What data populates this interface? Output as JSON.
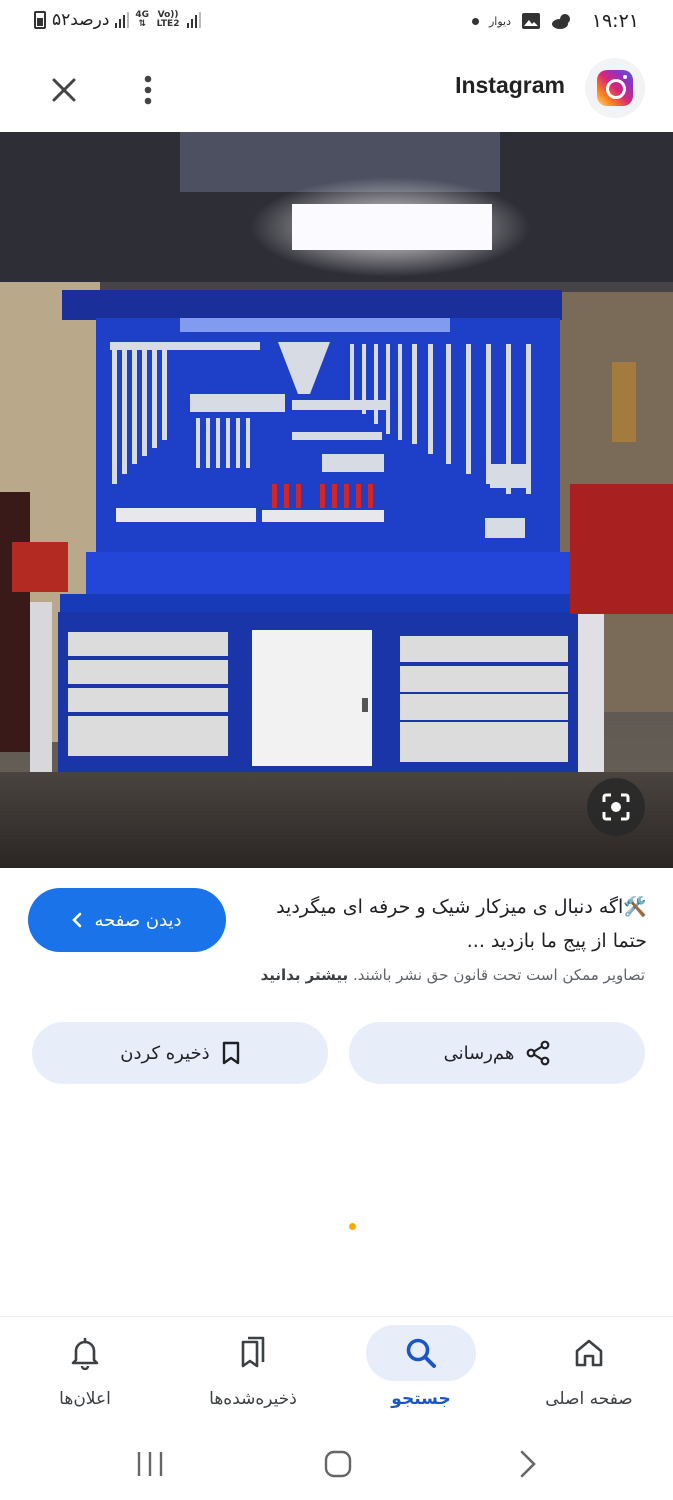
{
  "status_bar": {
    "time": "۱۹:۲۱",
    "app_label": "دیوار",
    "battery_text": "۵۲درصد",
    "network": "4G",
    "volte": "Vo)) LTE2"
  },
  "header": {
    "site_name": "Instagram"
  },
  "result": {
    "caption": "🛠️اگه دنبال ی میزکار شیک و حرفه ای میگردید حتما از پیج ما بازدید ...",
    "visit_label": "دیدن صفحه",
    "copyright_text": "تصاویر ممکن است تحت قانون حق نشر باشند.",
    "learn_more": "بیشتر بدانید",
    "share_label": "هم‌رسانی",
    "save_label": "ذخیره کردن"
  },
  "bottom_nav": {
    "items": [
      {
        "label": "صفحه اصلی",
        "icon": "home-icon"
      },
      {
        "label": "جستجو",
        "icon": "search-icon",
        "active": true
      },
      {
        "label": "ذخیره‌شده‌ها",
        "icon": "bookmarks-icon"
      },
      {
        "label": "اعلان‌ها",
        "icon": "bell-icon"
      }
    ]
  },
  "colors": {
    "accent": "#1a73e8",
    "chip_bg": "#e8eef9",
    "bench_blue": "#1f3fc4"
  }
}
